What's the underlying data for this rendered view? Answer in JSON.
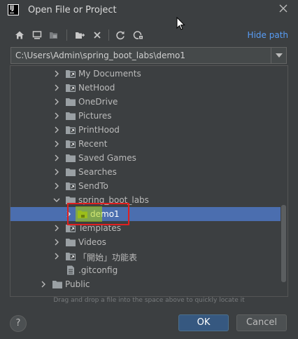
{
  "window": {
    "title": "Open File or Project",
    "logo_text": "IJ"
  },
  "toolbar": {
    "buttons": [
      "home-icon",
      "desktop-icon",
      "project-icon",
      "new-folder-icon",
      "delete-icon",
      "refresh-icon",
      "show-hidden-icon"
    ],
    "hide_path_label": "Hide path"
  },
  "path": {
    "value": "C:\\Users\\Admin\\spring_boot_labs\\demo1"
  },
  "tree": {
    "items": [
      {
        "label": "My Documents",
        "type": "link-folder",
        "expanded": false
      },
      {
        "label": "NetHood",
        "type": "link-folder",
        "expanded": false
      },
      {
        "label": "OneDrive",
        "type": "folder",
        "expanded": false
      },
      {
        "label": "Pictures",
        "type": "folder",
        "expanded": false
      },
      {
        "label": "PrintHood",
        "type": "link-folder",
        "expanded": false
      },
      {
        "label": "Recent",
        "type": "link-folder",
        "expanded": false
      },
      {
        "label": "Saved Games",
        "type": "folder",
        "expanded": false
      },
      {
        "label": "Searches",
        "type": "folder",
        "expanded": false
      },
      {
        "label": "SendTo",
        "type": "link-folder",
        "expanded": false
      },
      {
        "label": "spring_boot_labs",
        "type": "folder",
        "expanded": true
      },
      {
        "label": "demo1",
        "type": "project-folder",
        "expanded": false,
        "selected": true
      },
      {
        "label": "Templates",
        "type": "link-folder",
        "expanded": false
      },
      {
        "label": "Videos",
        "type": "folder",
        "expanded": false
      },
      {
        "label": "「開始」功能表",
        "type": "link-folder",
        "expanded": false
      },
      {
        "label": ".gitconfig",
        "type": "file",
        "expanded": false
      },
      {
        "label": "Public",
        "type": "folder",
        "expanded": false
      }
    ]
  },
  "hint": "Drag and drop a file into the space above to quickly locate it",
  "buttons": {
    "help": "?",
    "ok": "OK",
    "cancel": "Cancel"
  },
  "colors": {
    "background": "#3c3f41",
    "selection": "#4b6eaf",
    "link": "#589df6",
    "ok_button": "#365880",
    "highlight_border": "#e02020"
  }
}
